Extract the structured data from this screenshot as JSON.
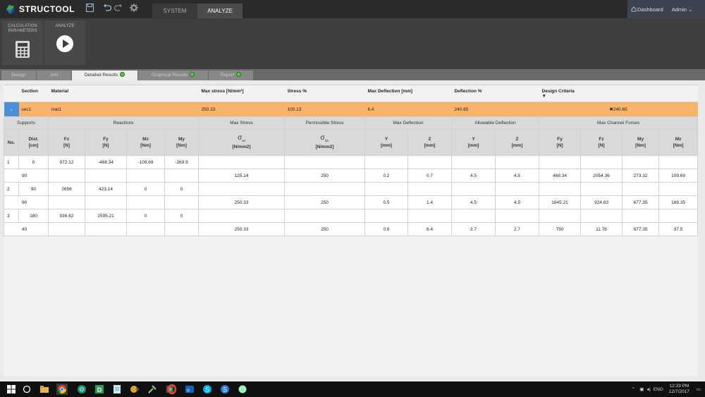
{
  "app": {
    "name": "STRUCTOOL",
    "top_tabs": [
      "SYSTEM",
      "ANALYZE"
    ],
    "dashboard_label": "Dashboard",
    "user_label": "Admin"
  },
  "ribbon": {
    "calc_label_1": "CALCULATION",
    "calc_label_2": "PARAMETERS",
    "analyze_label": "ANALYZE"
  },
  "subtabs": [
    {
      "label": "Design",
      "status": false
    },
    {
      "label": "Xml",
      "status": false
    },
    {
      "label": "Detailed Results",
      "status": true
    },
    {
      "label": "Graphical Results",
      "status": true
    },
    {
      "label": "Report",
      "status": true
    }
  ],
  "summary": {
    "headers": [
      "Section",
      "Material",
      "Max stress [N/mm²]",
      "Stress %",
      "Max Deflection [mm]",
      "Deflection %",
      "Design Criteria"
    ],
    "row": {
      "section": "sec1",
      "material": "mat1",
      "max_stress": "250.33",
      "stress_pct": "100.13",
      "max_deflection": "6.4",
      "deflection_pct": "240.65",
      "criteria": "240.65"
    }
  },
  "groups": [
    "Supports",
    "Reactions",
    "Max Stress",
    "Permissible Stress",
    "Max Deflection",
    "Allowable Deflection",
    "Max Channel Forces"
  ],
  "columns": {
    "no": "No.",
    "dist": [
      "Dist.",
      "[cm]"
    ],
    "fz": [
      "Fz",
      "[N]"
    ],
    "fy": [
      "Fy",
      "[N]"
    ],
    "mz": [
      "Mz",
      "[Nm]"
    ],
    "my": [
      "My",
      "[Nm]"
    ],
    "stress_unit": "[N/mm2]",
    "perm_unit": "[N/mm2]",
    "def_y": [
      "Y",
      "[mm]"
    ],
    "def_z": [
      "Z",
      "[mm]"
    ],
    "all_y": [
      "Y",
      "[mm]"
    ],
    "all_z": [
      "Z",
      "[mm]"
    ],
    "cf_fy": [
      "Fy",
      "[N]"
    ],
    "cf_fz": [
      "Fz",
      "[N]"
    ],
    "cf_my": [
      "My",
      "[Nm]"
    ],
    "cf_mz": [
      "Mz",
      "[Nm]"
    ]
  },
  "supports": [
    {
      "no": "1",
      "dist": "0",
      "fz": "972.12",
      "fy": "-468.34",
      "mz": "-109.69",
      "my": "-269.9"
    },
    {
      "no": "2",
      "dist": "90",
      "fz": "2656",
      "fy": "423.14",
      "mz": "0",
      "my": "0"
    },
    {
      "no": "3",
      "dist": "180",
      "fz": "936.62",
      "fy": "2595.21",
      "mz": "0",
      "my": "0"
    }
  ],
  "spans": [
    {
      "len": "90",
      "stress": "125.14",
      "perm": "250",
      "dy": "0.2",
      "dz": "0.7",
      "ay": "4.5",
      "az": "4.5",
      "fy": "468.34",
      "fz": "2054.36",
      "my": "273.32",
      "mz": "109.69"
    },
    {
      "len": "90",
      "stress": "250.33",
      "perm": "250",
      "dy": "0.5",
      "dz": "1.4",
      "ay": "4.5",
      "az": "4.5",
      "fy": "1845.21",
      "fz": "924.83",
      "my": "677.35",
      "mz": "189.35"
    },
    {
      "len": "40",
      "stress": "250.33",
      "perm": "250",
      "dy": "0.8",
      "dz": "6.4",
      "ay": "2.7",
      "az": "2.7",
      "fy": "750",
      "fz": "11.76",
      "my": "677.35",
      "mz": "37.5"
    }
  ],
  "taskbar": {
    "time": "12:33 PM",
    "date": "12/7/2017",
    "lang": "ENG"
  },
  "colors": {
    "accent_orange": "#f8b46a",
    "status_green": "#4fd13a",
    "topbar": "#2b2b2b"
  }
}
